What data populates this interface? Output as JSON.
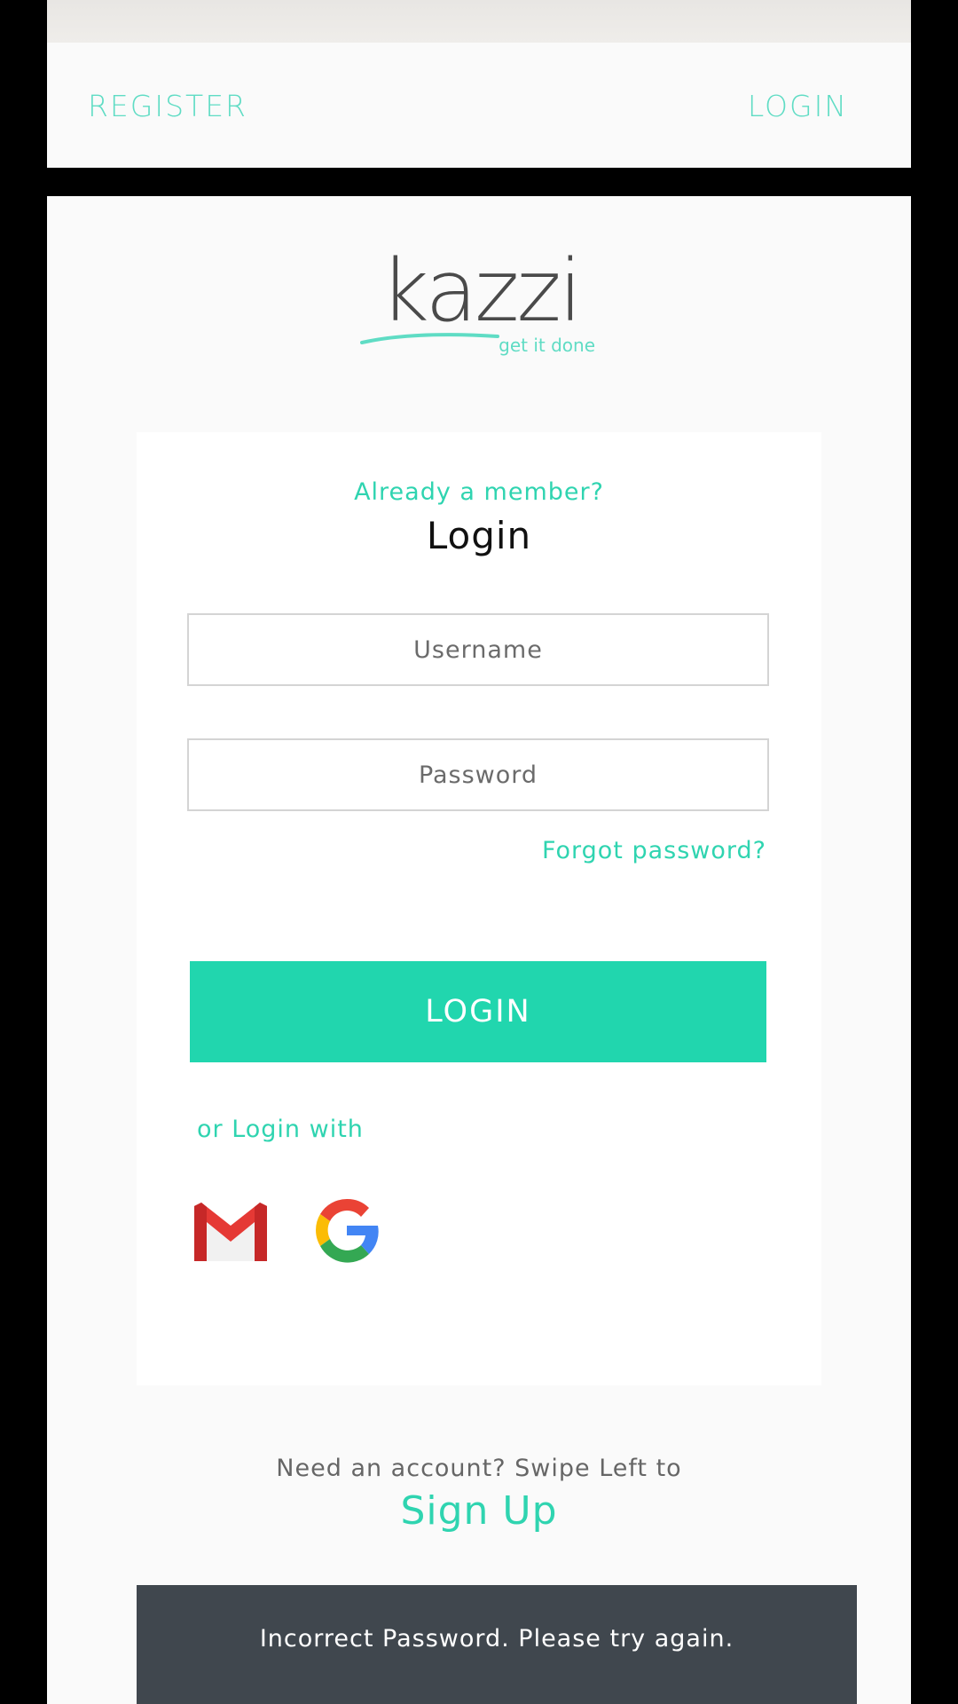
{
  "nav": {
    "register_label": "REGISTER",
    "login_label": "LOGIN"
  },
  "logo": {
    "wordmark": "kazzi",
    "tagline": "get it done"
  },
  "login_card": {
    "prompt": "Already a member?",
    "title": "Login",
    "username": {
      "placeholder": "Username",
      "value": ""
    },
    "password": {
      "placeholder": "Password",
      "value": ""
    },
    "forgot_password": "Forgot password?",
    "login_button": "LOGIN",
    "social_prompt": "or Login with",
    "social": [
      {
        "icon": "gmail-icon"
      },
      {
        "icon": "google-icon"
      }
    ]
  },
  "footer": {
    "swipe_text": "Need an account? Swipe Left to",
    "signup_label": "Sign Up"
  },
  "toast": {
    "message": "Incorrect Password. Please try again."
  },
  "colors": {
    "accent": "#21d6ae",
    "accent_text": "#2fd4b0",
    "toast_bg": "#40474e",
    "logo_text": "#4a4a4a"
  }
}
